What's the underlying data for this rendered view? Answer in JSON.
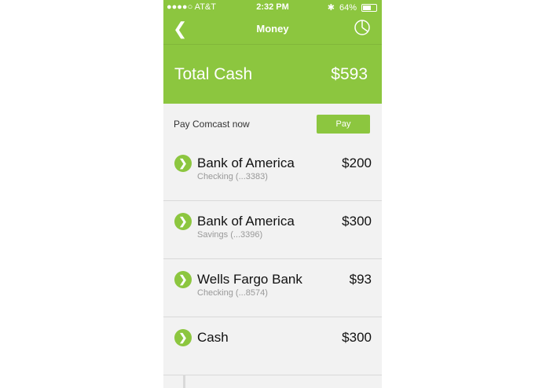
{
  "status": {
    "carrier": "●●●●○ AT&T",
    "time": "2:32 PM",
    "battery": "64%",
    "battery_level": 0.64
  },
  "nav": {
    "title": "Money",
    "back_icon": "chevron-left-icon",
    "chart_icon": "pie-chart-icon"
  },
  "total": {
    "label": "Total Cash",
    "value": "$593"
  },
  "pay": {
    "text": "Pay Comcast now",
    "button": "Pay"
  },
  "accounts": [
    {
      "name": "Bank of America",
      "sub": "Checking (...3383)",
      "amount": "$200"
    },
    {
      "name": "Bank of America",
      "sub": "Savings (...3396)",
      "amount": "$300"
    },
    {
      "name": "Wells Fargo Bank",
      "sub": "Checking (...8574)",
      "amount": "$93"
    },
    {
      "name": "Cash",
      "sub": "",
      "amount": "$300"
    }
  ],
  "colors": {
    "accent": "#8cc63f",
    "background": "#f2f2f2"
  }
}
